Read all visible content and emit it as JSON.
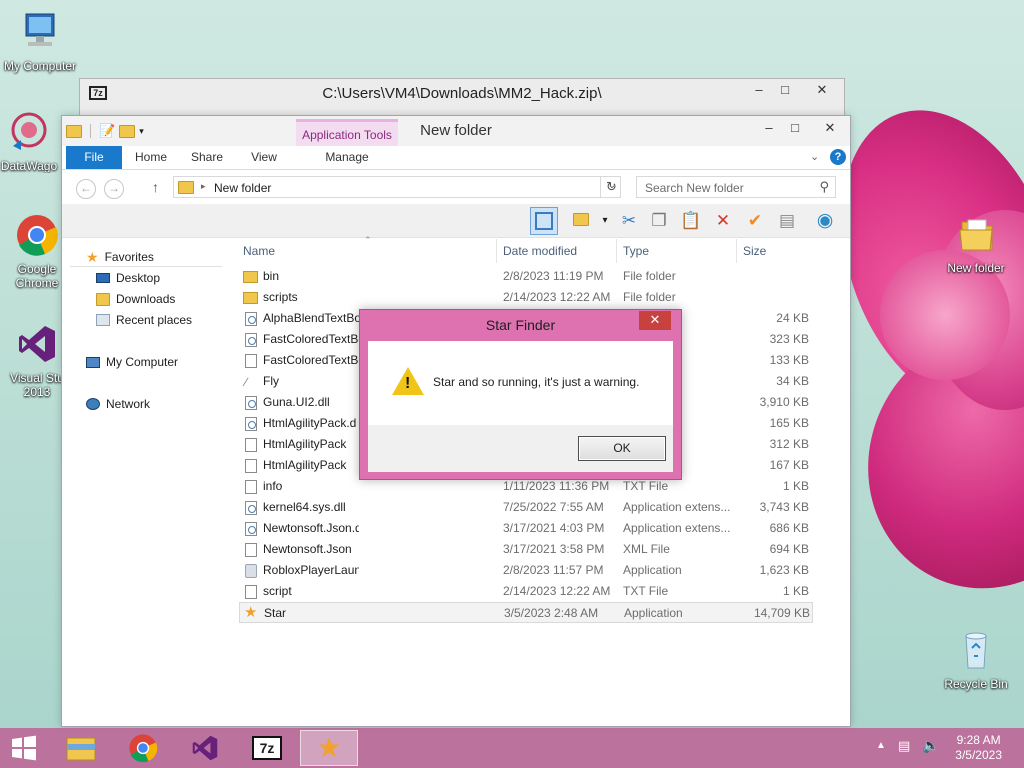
{
  "desktop": {
    "icons": [
      {
        "label": "My Computer"
      },
      {
        "label": "DataWago"
      },
      {
        "label": "Google Chrome"
      },
      {
        "label": "Visual Stu 2013"
      },
      {
        "label": "New folder"
      },
      {
        "label": "Recycle Bin"
      }
    ]
  },
  "zip_window": {
    "title": "C:\\Users\\VM4\\Downloads\\MM2_Hack.zip\\",
    "icon_label": "7z"
  },
  "explorer": {
    "title": "New folder",
    "context_tab": "Application Tools",
    "tabs": [
      "File",
      "Home",
      "Share",
      "View",
      "Manage"
    ],
    "address": "New folder",
    "search_placeholder": "Search New folder",
    "nav": {
      "favorites": "Favorites",
      "desktop": "Desktop",
      "downloads": "Downloads",
      "recent": "Recent places",
      "computer": "My Computer",
      "network": "Network"
    },
    "columns": {
      "name": "Name",
      "date": "Date modified",
      "type": "Type",
      "size": "Size"
    },
    "files": [
      {
        "name": "bin",
        "date": "2/8/2023 11:19 PM",
        "type": "File folder",
        "size": "",
        "icon": "folder"
      },
      {
        "name": "scripts",
        "date": "2/14/2023 12:22 AM",
        "type": "File folder",
        "size": "",
        "icon": "folder"
      },
      {
        "name": "AlphaBlendTextBo",
        "date": "",
        "type": "n extens...",
        "size": "24 KB",
        "icon": "dll"
      },
      {
        "name": "FastColoredTextBo",
        "date": "",
        "type": "n extens...",
        "size": "323 KB",
        "icon": "dll"
      },
      {
        "name": "FastColoredTextBo",
        "date": "",
        "type": "n",
        "size": "133 KB",
        "icon": "doc"
      },
      {
        "name": "Fly",
        "date": "",
        "type": "n",
        "size": "34 KB",
        "icon": "fly"
      },
      {
        "name": "Guna.UI2.dll",
        "date": "",
        "type": "n extens...",
        "size": "3,910 KB",
        "icon": "dll"
      },
      {
        "name": "HtmlAgilityPack.d",
        "date": "",
        "type": "n extens...",
        "size": "165 KB",
        "icon": "dll"
      },
      {
        "name": "HtmlAgilityPack",
        "date": "",
        "type": "ebug D...",
        "size": "312 KB",
        "icon": "doc"
      },
      {
        "name": "HtmlAgilityPack",
        "date": "",
        "type": "",
        "size": "167 KB",
        "icon": "doc"
      },
      {
        "name": "info",
        "date": "1/11/2023 11:36 PM",
        "type": "TXT File",
        "size": "1 KB",
        "icon": "doc"
      },
      {
        "name": "kernel64.sys.dll",
        "date": "7/25/2022 7:55 AM",
        "type": "Application extens...",
        "size": "3,743 KB",
        "icon": "dll"
      },
      {
        "name": "Newtonsoft.Json.dll",
        "date": "3/17/2021 4:03 PM",
        "type": "Application extens...",
        "size": "686 KB",
        "icon": "dll"
      },
      {
        "name": "Newtonsoft.Json",
        "date": "3/17/2021 3:58 PM",
        "type": "XML File",
        "size": "694 KB",
        "icon": "doc"
      },
      {
        "name": "RobloxPlayerLauncher",
        "date": "2/8/2023 11:57 PM",
        "type": "Application",
        "size": "1,623 KB",
        "icon": "app"
      },
      {
        "name": "script",
        "date": "2/14/2023 12:22 AM",
        "type": "TXT File",
        "size": "1 KB",
        "icon": "doc"
      },
      {
        "name": "Star",
        "date": "3/5/2023 2:48 AM",
        "type": "Application",
        "size": "14,709 KB",
        "icon": "star",
        "selected": true
      }
    ]
  },
  "dialog": {
    "title": "Star Finder",
    "message": "Star and so running, it's just a warning.",
    "ok_label": "OK"
  },
  "taskbar": {
    "time": "9:28 AM",
    "date": "3/5/2023",
    "zip_label": "7z"
  },
  "colors": {
    "accent_file_tab": "#1979ca",
    "dialog_frame": "#de72b0",
    "taskbar": "#be6094",
    "close_red": "#c7413f"
  }
}
